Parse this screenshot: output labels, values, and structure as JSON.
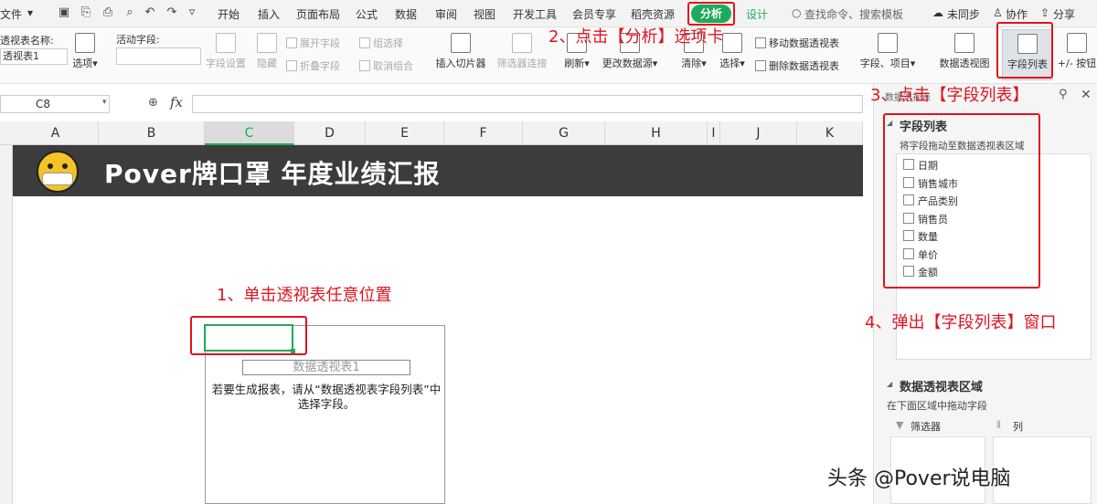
{
  "menu": {
    "file": "文件",
    "tabs": [
      "开始",
      "插入",
      "页面布局",
      "公式",
      "数据",
      "审阅",
      "视图",
      "开发工具",
      "会员专享",
      "稻壳资源"
    ],
    "analyze": "分析",
    "design": "设计",
    "search": "查找命令、搜索模板",
    "unsynced": "未同步",
    "collab": "协作",
    "share": "分享"
  },
  "ribbon": {
    "pivot_name_label": "透视表名称:",
    "pivot_name_value": "透视表1",
    "options": "选项",
    "active_field_label": "活动字段:",
    "field_settings": "字段设置",
    "hide": "隐藏",
    "expand_field": "展开字段",
    "collapse_field": "折叠字段",
    "group_selection": "组选择",
    "ungroup": "取消组合",
    "insert_slicer": "插入切片器",
    "filter_connection": "筛选器连接",
    "refresh": "刷新",
    "change_source": "更改数据源",
    "clear": "清除",
    "select": "选择",
    "move_pivot": "移动数据透视表",
    "delete_pivot": "删除数据透视表",
    "fields_items": "字段、项目",
    "pivot_chart": "数据透视图",
    "field_list": "字段列表",
    "buttons": "+/- 按钮"
  },
  "formula_bar": {
    "name_box": "C8",
    "fx": "fx"
  },
  "columns": [
    "A",
    "B",
    "C",
    "D",
    "E",
    "F",
    "G",
    "H",
    "I",
    "J",
    "K"
  ],
  "banner": {
    "title": "Pover牌口罩   年度业绩汇报"
  },
  "pivot": {
    "name": "数据透视表1",
    "hint": "若要生成报表，请从“数据透视表字段列表”中选择字段。"
  },
  "panel": {
    "title": "数据透视表",
    "field_list_title": "字段列表",
    "drag_hint": "将字段拖动至数据透视表区域",
    "fields": [
      "日期",
      "销售城市",
      "产品类别",
      "销售员",
      "数量",
      "单价",
      "金额"
    ],
    "areas_title": "数据透视表区域",
    "areas_hint": "在下面区域中拖动字段",
    "filter_area": "筛选器",
    "column_area": "列"
  },
  "annotations": {
    "step1": "1、单击透视表任意位置",
    "step2": "2、点击【分析】选项卡",
    "step3": "3、点击【字段列表】",
    "step4": "4、弹出【字段列表】窗口"
  },
  "watermark": "头条 @Pover说电脑",
  "colors": {
    "accent": "#1faa5b",
    "annotation": "#e0141e",
    "banner": "#3c3c3c"
  }
}
